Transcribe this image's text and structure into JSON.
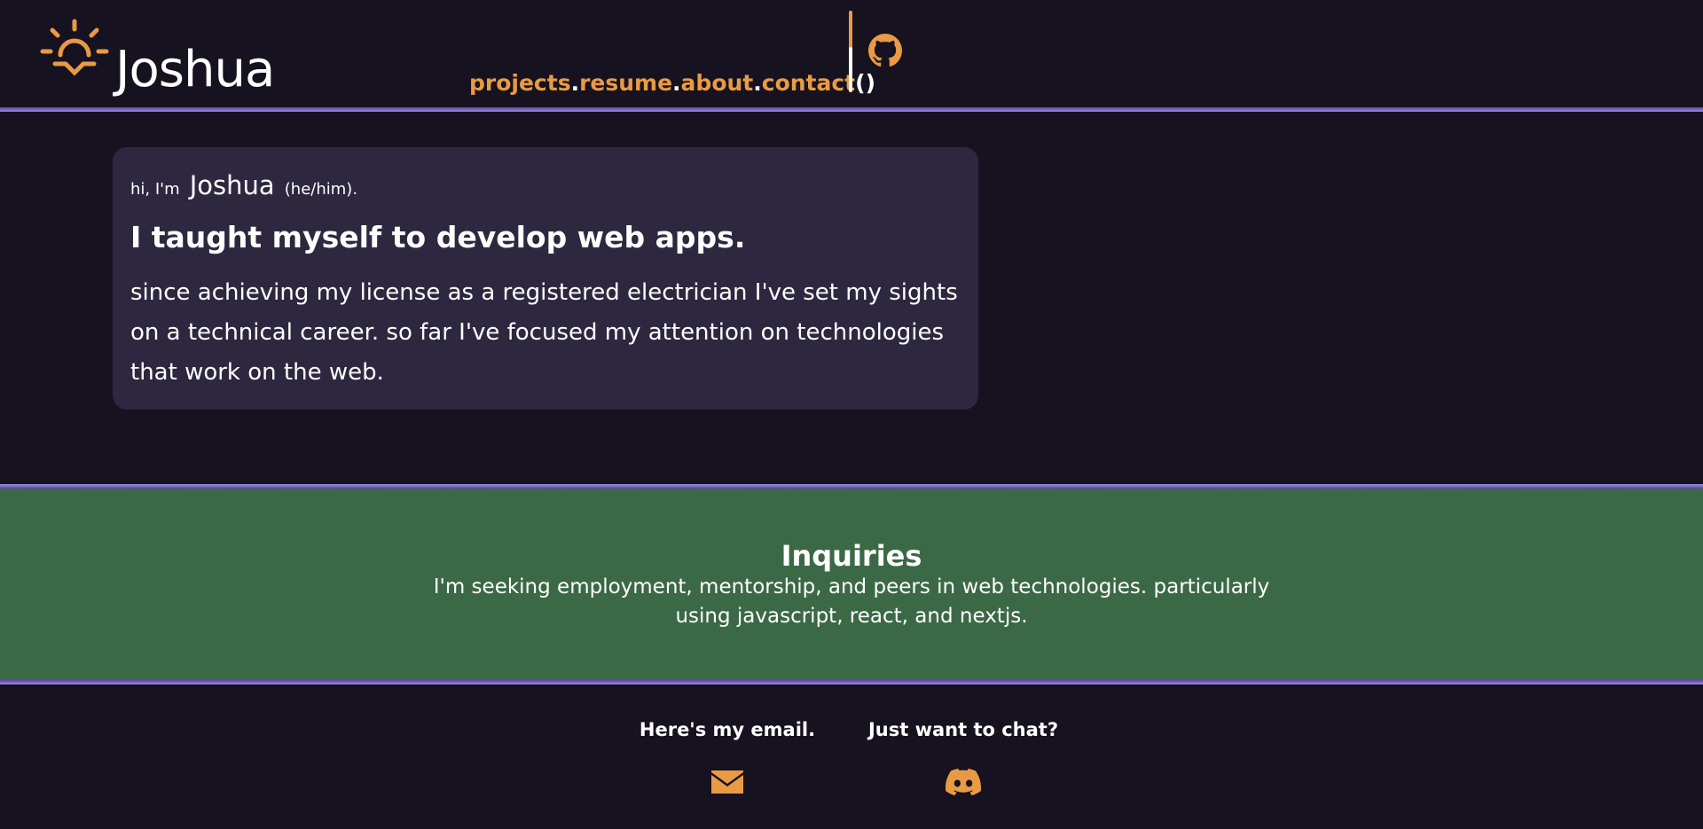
{
  "header": {
    "site_name": "Joshua",
    "nav": {
      "projects": "projects",
      "resume": "resume",
      "about": "about",
      "contact": "contact",
      "separator": ".",
      "parens": "()"
    },
    "github_icon": "github-icon",
    "logo_icon": "sunrise-icon"
  },
  "intro": {
    "greeting_prefix": "hi, I'm",
    "name": "Joshua",
    "pronouns": "(he/him).",
    "headline": "I taught myself to develop web apps.",
    "bio": "since achieving my license as a registered electrician I've set my sights on a technical career. so far I've focused my attention on technologies that work on the web."
  },
  "inquiries": {
    "title": "Inquiries",
    "text": "I'm seeking employment, mentorship, and peers in web technologies. particularly using javascript, react, and nextjs."
  },
  "contact": {
    "email_label": "Here's my email.",
    "email_icon": "envelope-icon",
    "chat_label": "Just want to chat?",
    "chat_icon": "discord-icon"
  },
  "colors": {
    "background": "#16121f",
    "accent": "#e99a44",
    "card": "#2d283f",
    "inquiries_bg": "#3b6945",
    "rule": "#9c8fdc"
  }
}
